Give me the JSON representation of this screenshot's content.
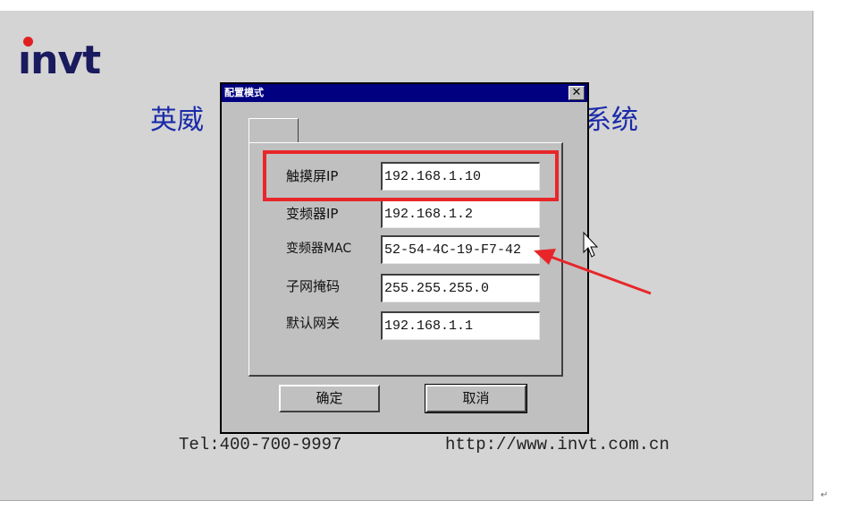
{
  "app": {
    "logo_text": "INVT",
    "banner_left": "英威",
    "banner_right": "系统",
    "footer_tel": "Tel:400-700-9997",
    "footer_url": "http://www.invt.com.cn"
  },
  "dialog": {
    "title": "配置模式",
    "close_glyph": "✕",
    "fields": [
      {
        "label": "触摸屏IP",
        "value": "192.168.1.10"
      },
      {
        "label": "变频器IP",
        "value": "192.168.1.2"
      },
      {
        "label": "变频器MAC",
        "value": "52-54-4C-19-F7-42"
      },
      {
        "label": "子网掩码",
        "value": "255.255.255.0"
      },
      {
        "label": "默认网关",
        "value": "192.168.1.1"
      }
    ],
    "ok_label": "确定",
    "cancel_label": "取消"
  },
  "annotation": {
    "color": "#e8262a",
    "highlighted_field": "触摸屏IP",
    "arrow_target_field": "变频器MAC"
  },
  "return_mark": "↵"
}
